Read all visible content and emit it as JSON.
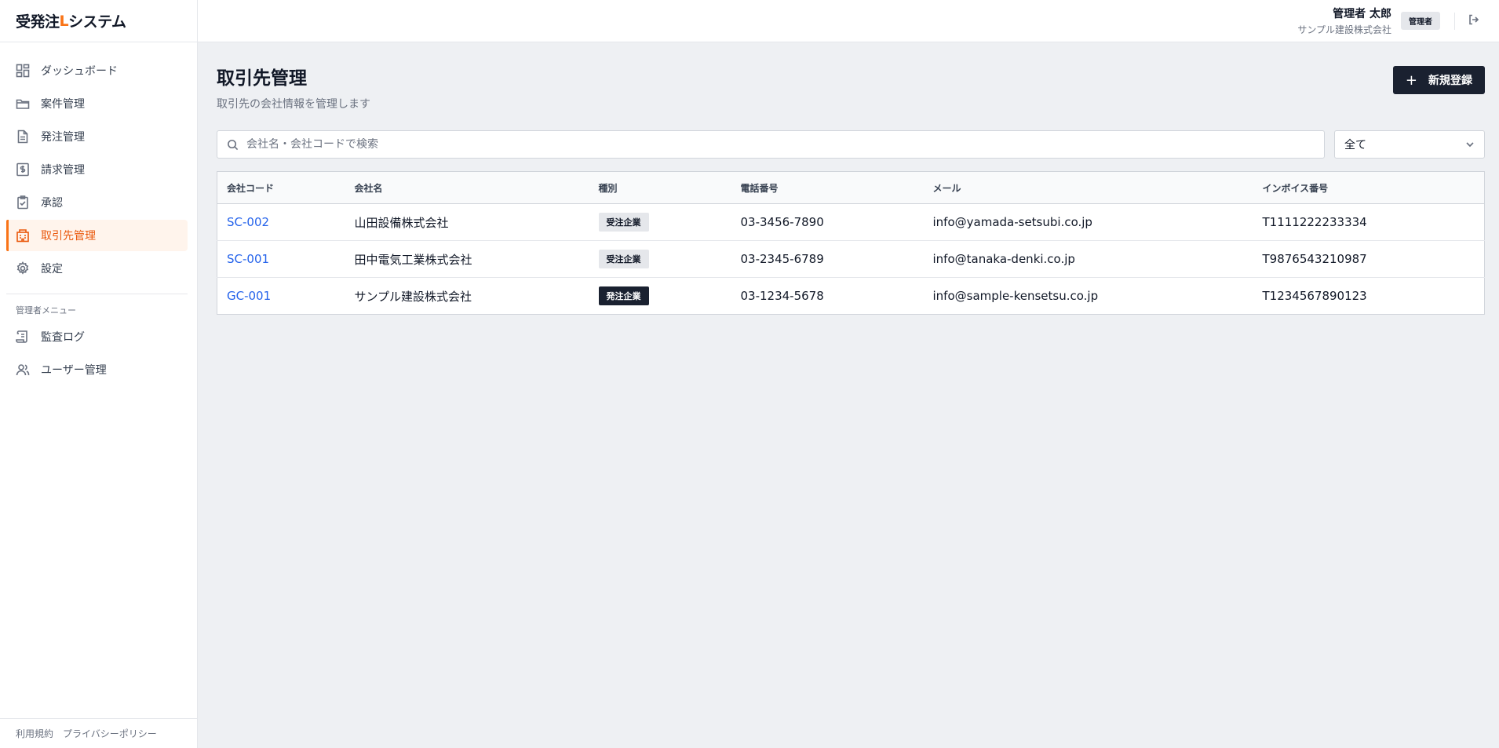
{
  "app": {
    "brand_prefix": "受発注",
    "brand_accent": "L",
    "brand_suffix": "システム",
    "accent_color": "#f97316"
  },
  "sidebar": {
    "items": [
      {
        "label": "ダッシュボード",
        "icon": "dashboard-icon"
      },
      {
        "label": "案件管理",
        "icon": "folder-icon"
      },
      {
        "label": "発注管理",
        "icon": "document-icon"
      },
      {
        "label": "請求管理",
        "icon": "invoice-icon"
      },
      {
        "label": "承認",
        "icon": "clipboard-check-icon"
      },
      {
        "label": "取引先管理",
        "icon": "building-icon",
        "active": true
      },
      {
        "label": "設定",
        "icon": "gear-icon"
      }
    ],
    "admin_section_label": "管理者メニュー",
    "admin_items": [
      {
        "label": "監査ログ",
        "icon": "scroll-icon"
      },
      {
        "label": "ユーザー管理",
        "icon": "users-icon"
      }
    ],
    "footer": {
      "terms": "利用規約",
      "privacy": "プライバシーポリシー"
    }
  },
  "header": {
    "user_name": "管理者 太郎",
    "company": "サンプル建設株式会社",
    "role_badge": "管理者"
  },
  "page": {
    "title": "取引先管理",
    "subtitle": "取引先の会社情報を管理します",
    "new_button": "新規登録"
  },
  "search": {
    "placeholder": "会社名・会社コードで検索",
    "value": ""
  },
  "filter": {
    "selected": "全て"
  },
  "table": {
    "columns": [
      "会社コード",
      "会社名",
      "種別",
      "電話番号",
      "メール",
      "インボイス番号"
    ],
    "rows": [
      {
        "code": "SC-002",
        "name": "山田設備株式会社",
        "type": "受注企業",
        "type_kind": "receive",
        "phone": "03-3456-7890",
        "email": "info@yamada-setsubi.co.jp",
        "invoice": "T1111222233334"
      },
      {
        "code": "SC-001",
        "name": "田中電気工業株式会社",
        "type": "受注企業",
        "type_kind": "receive",
        "phone": "03-2345-6789",
        "email": "info@tanaka-denki.co.jp",
        "invoice": "T9876543210987"
      },
      {
        "code": "GC-001",
        "name": "サンプル建設株式会社",
        "type": "発注企業",
        "type_kind": "order",
        "phone": "03-1234-5678",
        "email": "info@sample-kensetsu.co.jp",
        "invoice": "T1234567890123"
      }
    ]
  }
}
